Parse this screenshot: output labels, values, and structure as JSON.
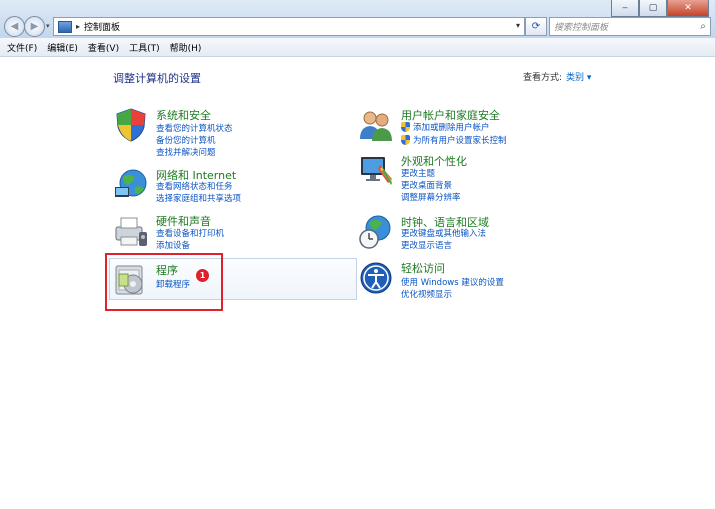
{
  "window": {
    "address": {
      "crumb": "控制面板",
      "recent_glyph": "▾",
      "dropdown_glyph": "▾"
    },
    "search": {
      "placeholder": "搜索控制面板"
    },
    "buttons": {
      "back": "◀",
      "forward": "▶",
      "refresh": "⟳",
      "minimize": "‒",
      "maximize": "▢",
      "close": "✕"
    }
  },
  "menubar": [
    "文件(F)",
    "编辑(E)",
    "查看(V)",
    "工具(T)",
    "帮助(H)"
  ],
  "main": {
    "title": "调整计算机的设置",
    "view_by_label": "查看方式:",
    "view_by_value": "类别 ▾"
  },
  "categories": {
    "system": {
      "title": "系统和安全",
      "links": [
        "查看您的计算机状态",
        "备份您的计算机",
        "查找并解决问题"
      ]
    },
    "network": {
      "title": "网络和 Internet",
      "links": [
        "查看网络状态和任务",
        "选择家庭组和共享选项"
      ]
    },
    "hardware": {
      "title": "硬件和声音",
      "links": [
        "查看设备和打印机",
        "添加设备"
      ]
    },
    "programs": {
      "title": "程序",
      "links": [
        "卸载程序"
      ]
    },
    "user": {
      "title": "用户帐户和家庭安全",
      "links": [
        "添加或删除用户帐户",
        "为所有用户设置家长控制"
      ]
    },
    "appearance": {
      "title": "外观和个性化",
      "links": [
        "更改主题",
        "更改桌面背景",
        "调整屏幕分辨率"
      ]
    },
    "clock": {
      "title": "时钟、语言和区域",
      "links": [
        "更改键盘或其他输入法",
        "更改显示语言"
      ]
    },
    "ease": {
      "title": "轻松访问",
      "links": [
        "使用 Windows 建议的设置",
        "优化视频显示"
      ]
    }
  },
  "annotation": {
    "badge": "1",
    "color": "#e0202a"
  },
  "colors": {
    "heading_green": "#1e7a21",
    "link_blue": "#0b55c4",
    "title_blue": "#1e3287"
  }
}
